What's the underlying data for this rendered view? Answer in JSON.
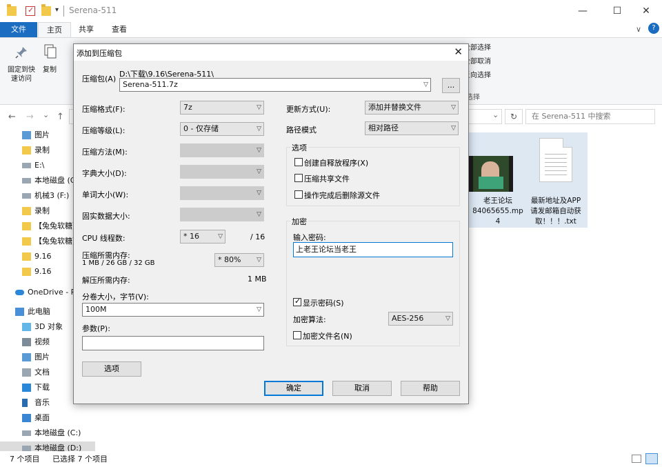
{
  "window": {
    "title": "Serena-511",
    "min_glyph": "—",
    "max_glyph": "☐",
    "close_glyph": "✕",
    "qa_dropdown_glyph": "▾"
  },
  "ribbon": {
    "tabs": [
      "文件",
      "主页",
      "共享",
      "查看"
    ],
    "labels": {
      "pin_quick_access": "固定到快\n速访问",
      "copy": "复制",
      "select_all": "全部选择",
      "select_none": "全部取消",
      "invert_selection": "反向选择",
      "select_group": "选择"
    },
    "collapse_glyph": "∨",
    "help_glyph": "?"
  },
  "address": {
    "back": "←",
    "forward": "→",
    "recent": "⌄",
    "up": "↑",
    "dropdown": "⌄",
    "refresh": "↻",
    "search_placeholder": "在 Serena-511 中搜索"
  },
  "nav": {
    "items": [
      {
        "label": "图片",
        "icon": "pictures-icon"
      },
      {
        "label": "录制",
        "icon": "folder-icon"
      },
      {
        "label": "E:\\",
        "icon": "drive-icon"
      },
      {
        "label": "本地磁盘 (G:)",
        "icon": "drive-icon"
      },
      {
        "label": "机械3 (F:)",
        "icon": "drive-icon"
      },
      {
        "label": "录制",
        "icon": "folder-icon"
      },
      {
        "label": "【兔兔软糖】",
        "icon": "folder-icon"
      },
      {
        "label": "【兔兔软糖】",
        "icon": "folder-icon"
      },
      {
        "label": "9.16",
        "icon": "folder-icon"
      },
      {
        "label": "9.16",
        "icon": "folder-icon"
      },
      {
        "label": "OneDrive - P",
        "icon": "onedrive-icon"
      },
      {
        "label": "此电脑",
        "icon": "computer-icon"
      },
      {
        "label": "3D 对象",
        "icon": "3d-objects-icon"
      },
      {
        "label": "视频",
        "icon": "videos-icon"
      },
      {
        "label": "图片",
        "icon": "pictures-icon"
      },
      {
        "label": "文档",
        "icon": "documents-icon"
      },
      {
        "label": "下载",
        "icon": "downloads-icon"
      },
      {
        "label": "音乐",
        "icon": "music-icon"
      },
      {
        "label": "桌面",
        "icon": "desktop-icon"
      },
      {
        "label": "本地磁盘 (C:)",
        "icon": "drive-icon"
      },
      {
        "label": "本地磁盘 (D:)",
        "icon": "drive-icon"
      }
    ]
  },
  "files": [
    {
      "name": "老王论坛\n84065655.mp\n4",
      "kind": "video"
    },
    {
      "name": "最新地址及APP\n请发邮箱自动获\n取！！！.txt",
      "kind": "text"
    }
  ],
  "status": {
    "count": "7 个项目",
    "selected": "已选择 7 个项目"
  },
  "dialog": {
    "title": "添加到压缩包",
    "close": "✕",
    "archive_label": "压缩包(A)",
    "archive_path": "D:\\下载\\9.16\\Serena-511\\",
    "archive_name": "Serena-511.7z",
    "browse": "...",
    "format_label": "压缩格式(F):",
    "format_value": "7z",
    "level_label": "压缩等级(L):",
    "level_value": "0 - 仅存储",
    "method_label": "压缩方法(M):",
    "dict_label": "字典大小(D):",
    "word_label": "单词大小(W):",
    "solid_label": "固实数据大小:",
    "cpu_label": "CPU 线程数:",
    "cpu_value": "* 16",
    "cpu_total": "/ 16",
    "mem_compress_label": "压缩所需内存:",
    "mem_compress_detail": "1 MB / 26 GB / 32 GB",
    "mem_percent": "* 80%",
    "mem_decompress_label": "解压所需内存:",
    "mem_decompress_value": "1 MB",
    "split_label": "分卷大小，字节(V):",
    "split_value": "100M",
    "params_label": "参数(P):",
    "params_value": "",
    "options_button": "选项",
    "update_label": "更新方式(U):",
    "update_value": "添加并替换文件",
    "path_label": "路径模式",
    "path_value": "相对路径",
    "options_group": "选项",
    "opt_sfx": "创建自释放程序(X)",
    "opt_shared": "压缩共享文件",
    "opt_delete": "操作完成后删除源文件",
    "encrypt_group": "加密",
    "password_label": "输入密码:",
    "password_value": "上老王论坛当老王",
    "show_password": "显示密码(S)",
    "encrypt_method_label": "加密算法:",
    "encrypt_method_value": "AES-256",
    "encrypt_names": "加密文件名(N)",
    "ok": "确定",
    "cancel": "取消",
    "help": "帮助"
  }
}
